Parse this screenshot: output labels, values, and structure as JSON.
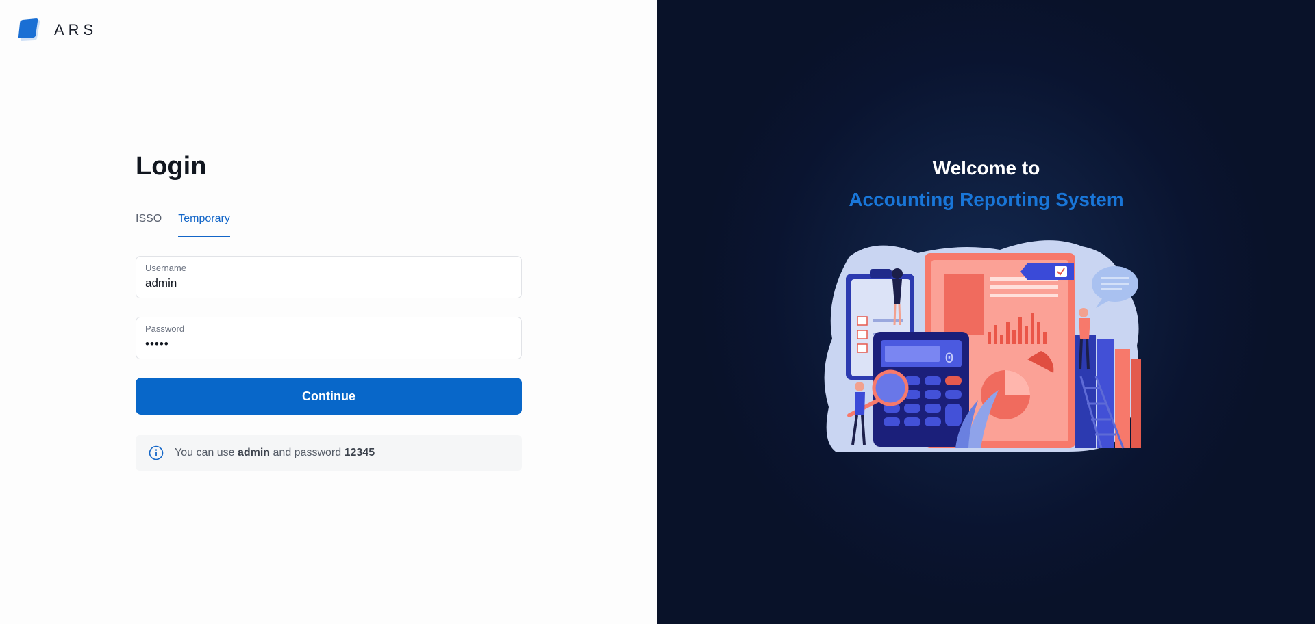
{
  "brand": {
    "name": "ARS",
    "logo_icon": "ars-logo-icon",
    "logo_color": "#1a6fd4"
  },
  "login": {
    "title": "Login",
    "tabs": [
      {
        "label": "ISSO",
        "active": false
      },
      {
        "label": "Temporary",
        "active": true
      }
    ],
    "username": {
      "label": "Username",
      "value": "admin"
    },
    "password": {
      "label": "Password",
      "value": "12345"
    },
    "continue_label": "Continue",
    "info": {
      "icon": "info-circle-icon",
      "prefix": "You can use",
      "user": "admin",
      "middle": "and password",
      "pass": "12345"
    }
  },
  "welcome": {
    "line1": "Welcome to",
    "line2": "Accounting Reporting System"
  },
  "colors": {
    "accent": "#0867c9",
    "dark_bg": "#0a1430",
    "highlight": "#1976d8"
  },
  "illustration": {
    "icon": "accounting-illustration",
    "calculator_display": "0"
  }
}
